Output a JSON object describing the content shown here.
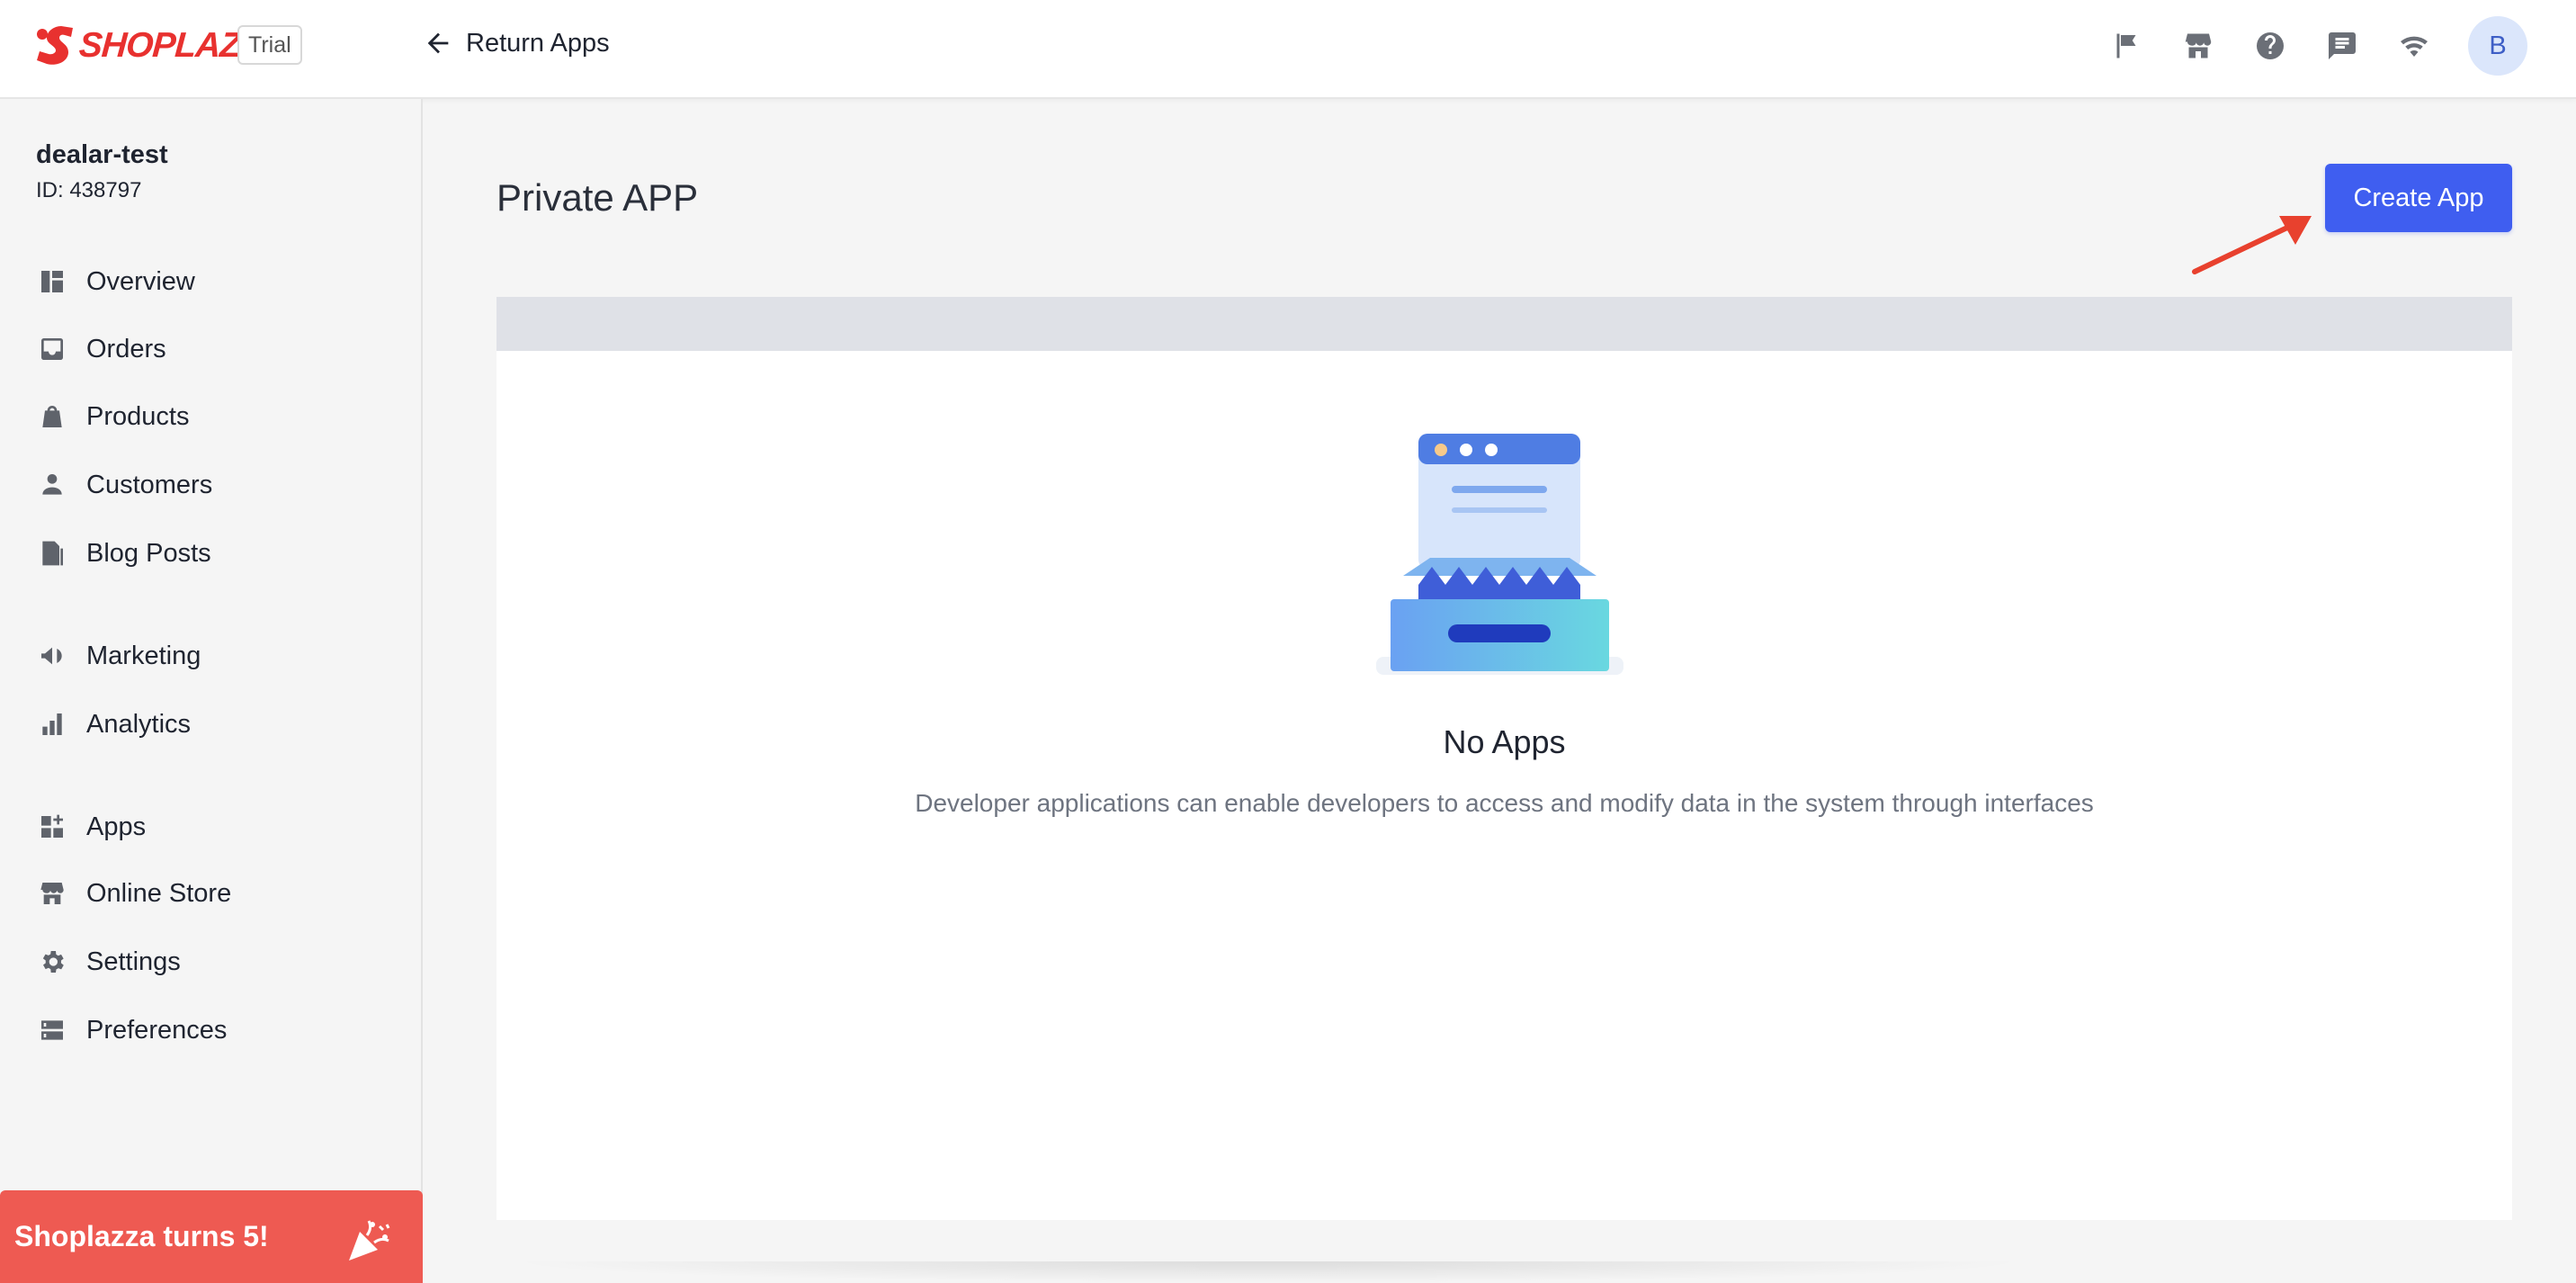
{
  "header": {
    "brand": "SHOPLAZZA",
    "trial_label": "Trial",
    "return_label": "Return Apps",
    "icons": [
      "flag-icon",
      "store-icon",
      "help-icon",
      "chat-icon",
      "wifi-icon"
    ],
    "avatar_initial": "B"
  },
  "sidebar": {
    "store_name": "dealar-test",
    "store_id": "ID: 438797",
    "items": [
      {
        "label": "Overview",
        "icon": "dashboard-icon"
      },
      {
        "label": "Orders",
        "icon": "inbox-icon"
      },
      {
        "label": "Products",
        "icon": "bag-icon"
      },
      {
        "label": "Customers",
        "icon": "person-icon"
      },
      {
        "label": "Blog Posts",
        "icon": "document-icon"
      },
      {
        "label": "Marketing",
        "icon": "megaphone-icon"
      },
      {
        "label": "Analytics",
        "icon": "bar-chart-icon"
      },
      {
        "label": "Apps",
        "icon": "apps-icon"
      },
      {
        "label": "Online Store",
        "icon": "store-icon"
      },
      {
        "label": "Settings",
        "icon": "gear-icon"
      },
      {
        "label": "Preferences",
        "icon": "server-icon"
      }
    ],
    "promo_label": "Shoplazza turns 5!"
  },
  "main": {
    "title": "Private APP",
    "create_button": "Create App",
    "empty_title": "No Apps",
    "empty_description": "Developer applications can enable developers to access and modify data in the system through interfaces"
  },
  "colors": {
    "brand_red": "#e8312f",
    "primary_blue": "#3f5ef0",
    "promo_red": "#ee5a52",
    "arrow_red": "#e8412e"
  }
}
